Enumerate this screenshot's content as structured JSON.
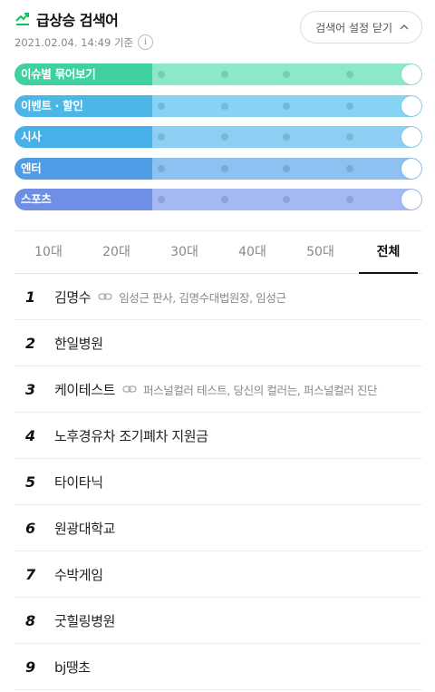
{
  "header": {
    "title": "급상승 검색어",
    "timestamp": "2021.02.04. 14:49 기준",
    "info_glyph": "i",
    "close_settings_label": "검색어 설정 닫기"
  },
  "toggles": [
    {
      "label": "이슈별 묶어보기",
      "fill": "#3ed0a0",
      "track": "#8ce8cb",
      "on": true
    },
    {
      "label": "이벤트 · 할인",
      "fill": "#4cb7e6",
      "track": "#86d3f5",
      "on": true
    },
    {
      "label": "시사",
      "fill": "#47b0e8",
      "track": "#8ccff3",
      "on": true
    },
    {
      "label": "엔터",
      "fill": "#4e9be6",
      "track": "#8dc1f2",
      "on": true
    },
    {
      "label": "스포츠",
      "fill": "#6f8ee5",
      "track": "#a4b8f1",
      "on": true
    }
  ],
  "tabs": [
    {
      "label": "10대",
      "active": false
    },
    {
      "label": "20대",
      "active": false
    },
    {
      "label": "30대",
      "active": false
    },
    {
      "label": "40대",
      "active": false
    },
    {
      "label": "50대",
      "active": false
    },
    {
      "label": "전체",
      "active": true
    }
  ],
  "ranking": [
    {
      "rank": "1",
      "keyword": "김명수",
      "related": "임성근 판사, 김명수대법원장, 임성근"
    },
    {
      "rank": "2",
      "keyword": "한일병원",
      "related": ""
    },
    {
      "rank": "3",
      "keyword": "케이테스트",
      "related": "퍼스널컬러 테스트, 당신의 컬러는, 퍼스널컬러 진단"
    },
    {
      "rank": "4",
      "keyword": "노후경유차 조기폐차 지원금",
      "related": ""
    },
    {
      "rank": "5",
      "keyword": "타이타닉",
      "related": ""
    },
    {
      "rank": "6",
      "keyword": "원광대학교",
      "related": ""
    },
    {
      "rank": "7",
      "keyword": "수박게임",
      "related": ""
    },
    {
      "rank": "8",
      "keyword": "굿힐링병원",
      "related": ""
    },
    {
      "rank": "9",
      "keyword": "bj땡초",
      "related": ""
    }
  ],
  "colors": {
    "accent": "#03c75a",
    "text": "#222222",
    "muted": "#888888"
  },
  "icons": {
    "trend": "trend-up-icon",
    "info": "info-icon",
    "chevron": "chevron-up-icon",
    "link": "link-icon"
  }
}
